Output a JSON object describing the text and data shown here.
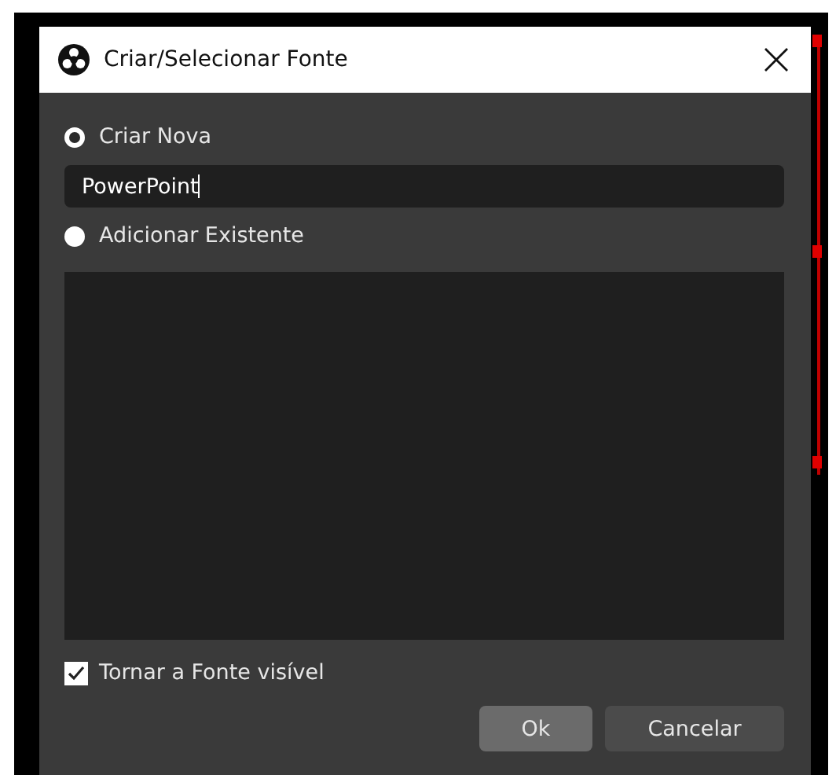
{
  "window": {
    "title": "Criar/Selecionar Fonte"
  },
  "options": [
    {
      "label": "Criar Nova",
      "selected": true
    },
    {
      "label": "Adicionar Existente",
      "selected": false
    }
  ],
  "name_field": {
    "value": "PowerPoint"
  },
  "visible_checkbox": {
    "label": "Tornar a Fonte visível",
    "checked": true
  },
  "buttons": [
    {
      "label": "Ok",
      "kind": "primary"
    },
    {
      "label": "Cancelar",
      "kind": "secondary"
    }
  ]
}
